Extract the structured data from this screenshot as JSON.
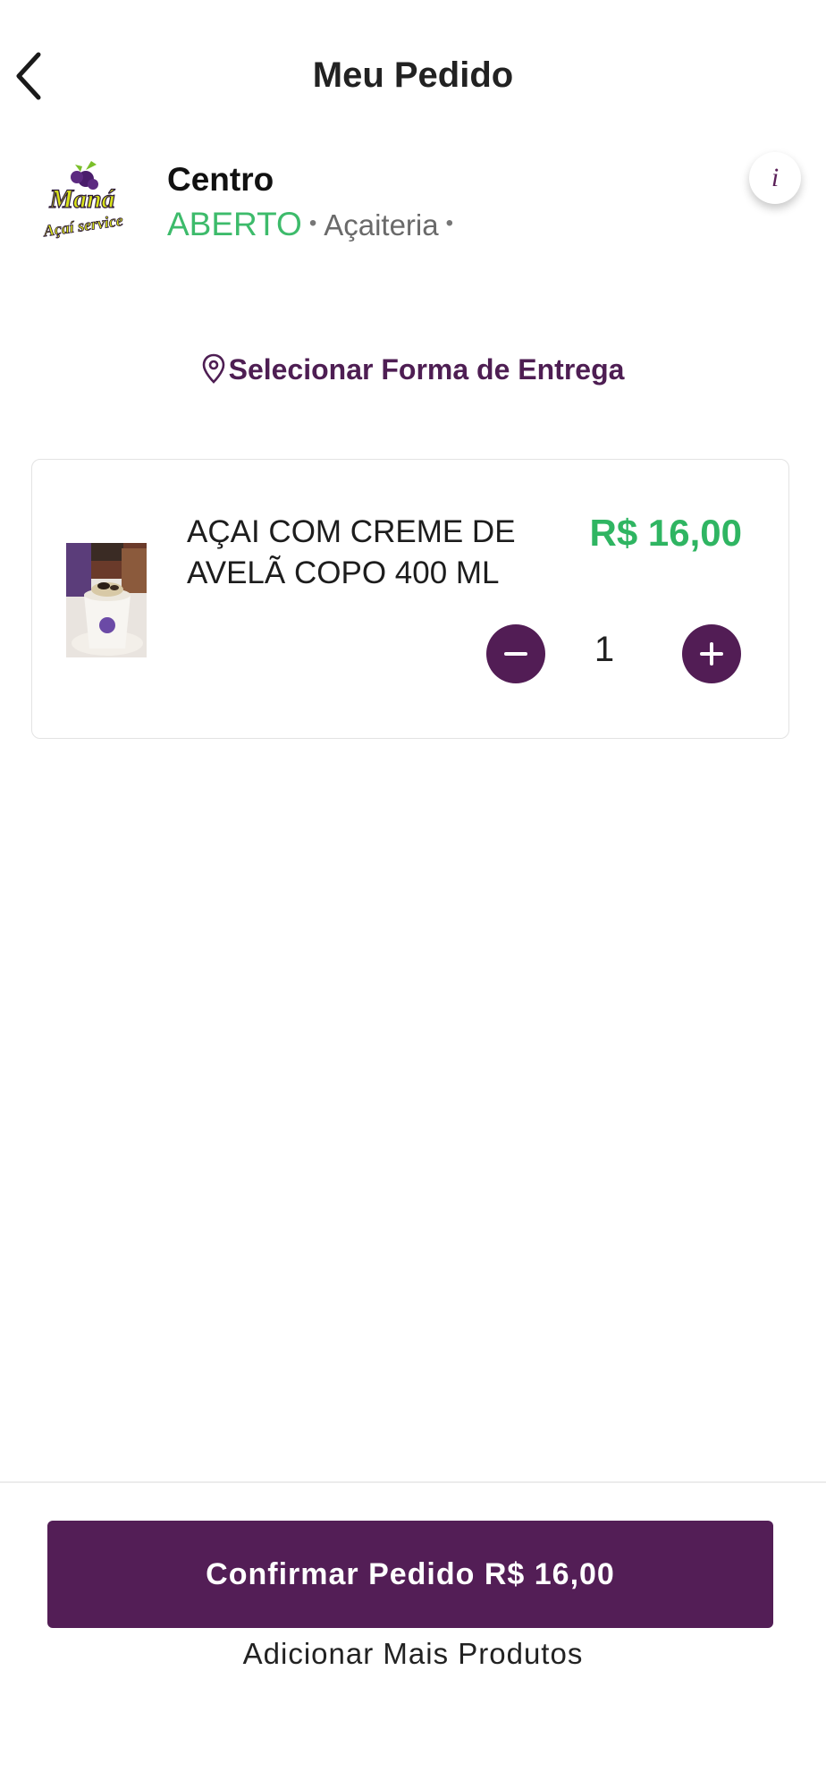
{
  "header": {
    "title": "Meu Pedido"
  },
  "store": {
    "logo_text_1": "Maná",
    "logo_text_2": "Açaí service",
    "name": "Centro",
    "status": "ABERTO",
    "category": "Açaiteria",
    "info_label": "i"
  },
  "delivery": {
    "label": "Selecionar Forma de Entrega"
  },
  "cart": {
    "items": [
      {
        "name": "AÇAI COM CREME DE AVELÃ COPO 400 ML",
        "price": "R$ 16,00",
        "quantity": "1"
      }
    ]
  },
  "footer": {
    "confirm_label": "Confirmar Pedido R$ 16,00",
    "add_more_label": "Adicionar Mais Produtos"
  },
  "colors": {
    "brand_purple": "#531e56",
    "status_green": "#3dbb6b",
    "price_green": "#2fb562"
  }
}
